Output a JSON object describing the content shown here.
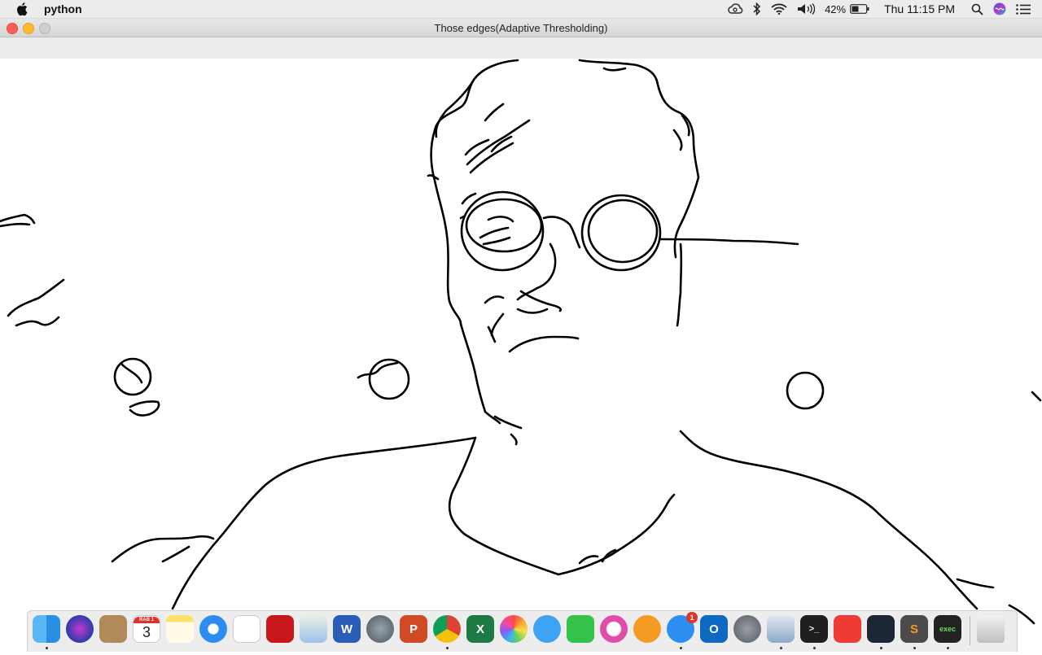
{
  "menubar": {
    "app_name": "python",
    "battery": "42%",
    "clock": "Thu 11:15 PM",
    "icons": [
      "creative-cloud-icon",
      "bluetooth-icon",
      "wifi-icon",
      "volume-icon",
      "battery-icon",
      "search-icon",
      "siri-icon",
      "notification-center-icon"
    ]
  },
  "window": {
    "title": "Those edges(Adaptive Thresholding)"
  },
  "dock": {
    "items": [
      {
        "name": "finder",
        "label": ""
      },
      {
        "name": "siri",
        "label": ""
      },
      {
        "name": "contacts",
        "label": ""
      },
      {
        "name": "calendar",
        "label": "3",
        "month": "RAB 1"
      },
      {
        "name": "notes",
        "label": ""
      },
      {
        "name": "safari",
        "label": ""
      },
      {
        "name": "reminders",
        "label": ""
      },
      {
        "name": "acrobat",
        "label": ""
      },
      {
        "name": "preview",
        "label": ""
      },
      {
        "name": "word",
        "label": "W"
      },
      {
        "name": "launchpad",
        "label": ""
      },
      {
        "name": "powerpoint",
        "label": "P"
      },
      {
        "name": "chrome",
        "label": ""
      },
      {
        "name": "excel",
        "label": "X"
      },
      {
        "name": "photos",
        "label": ""
      },
      {
        "name": "messages",
        "label": ""
      },
      {
        "name": "facetime",
        "label": ""
      },
      {
        "name": "itunes",
        "label": ""
      },
      {
        "name": "books",
        "label": ""
      },
      {
        "name": "app-store",
        "label": "",
        "badge": "1"
      },
      {
        "name": "outlook",
        "label": "O"
      },
      {
        "name": "system-preferences",
        "label": ""
      },
      {
        "name": "python-launcher",
        "label": ""
      },
      {
        "name": "terminal",
        "label": ">_"
      },
      {
        "name": "anydesk",
        "label": ""
      },
      {
        "name": "filmora",
        "label": ""
      },
      {
        "name": "sublime-text",
        "label": "S"
      },
      {
        "name": "exec",
        "label": "exec"
      },
      {
        "name": "trash",
        "label": ""
      }
    ]
  }
}
